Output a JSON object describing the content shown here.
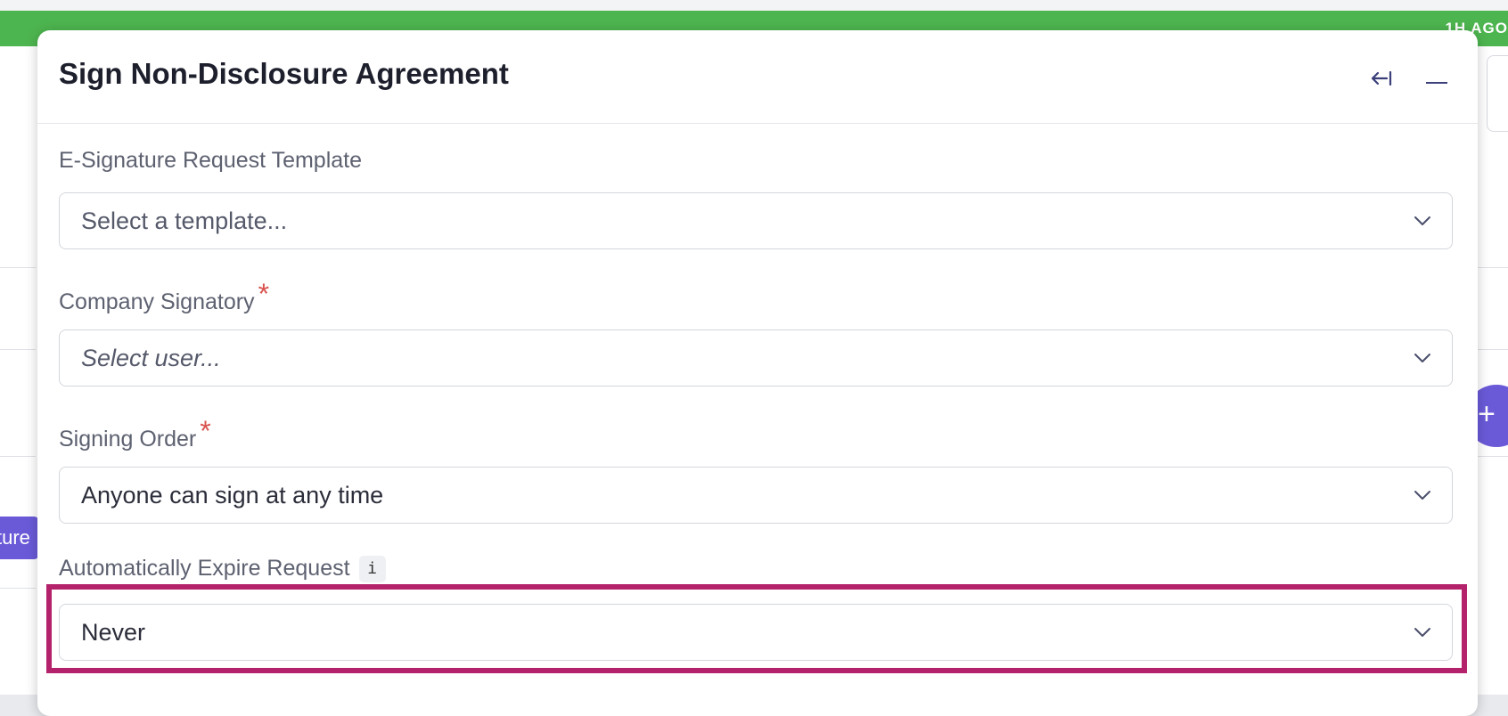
{
  "background": {
    "time_badge": "1H AGO",
    "side_tab_text": "ture",
    "fab_symbol": "+"
  },
  "modal": {
    "title": "Sign Non-Disclosure Agreement",
    "collapse_icon": "arrow-left-to-line-icon",
    "minimize_icon": "minimize-icon",
    "fields": [
      {
        "label": "E-Signature Request Template",
        "required": false,
        "value": "Select a template...",
        "style": "placeholder"
      },
      {
        "label": "Company Signatory",
        "required": true,
        "value": "Select user...",
        "style": "italic"
      },
      {
        "label": "Signing Order",
        "required": true,
        "value": "Anyone can sign at any time",
        "style": "value"
      },
      {
        "label": "Automatically Expire Request",
        "required": false,
        "info": "i",
        "value": "Never",
        "style": "value"
      }
    ],
    "required_marker": "*"
  },
  "colors": {
    "accent_green": "#4db54f",
    "accent_purple": "#6a5ad8",
    "highlight": "#b3226a",
    "required": "#d9534f"
  }
}
